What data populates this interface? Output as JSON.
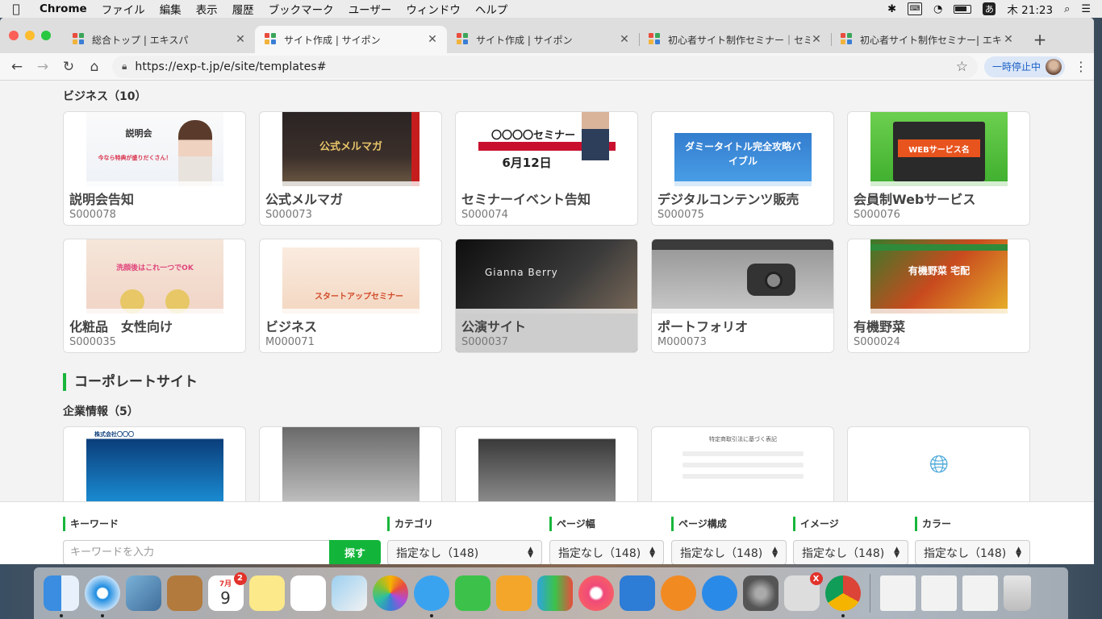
{
  "menubar": {
    "app": "Chrome",
    "items": [
      "ファイル",
      "編集",
      "表示",
      "履歴",
      "ブックマーク",
      "ユーザー",
      "ウィンドウ",
      "ヘルプ"
    ],
    "ime": "あ",
    "clock": "木 21:23"
  },
  "tabs": [
    {
      "title": "総合トップ | エキスパ",
      "active": false
    },
    {
      "title": "サイト作成 | サイポン",
      "active": true
    },
    {
      "title": "サイト作成 | サイポン",
      "active": false
    },
    {
      "title": "初心者サイト制作セミナー｜セミナ",
      "active": false
    },
    {
      "title": "初心者サイト制作セミナー| エキス",
      "active": false
    }
  ],
  "toolbar": {
    "url": "https://exp-t.jp/e/site/templates#",
    "pause_label": "一時停止中"
  },
  "business": {
    "heading": "ビジネス（10）",
    "cards": [
      {
        "title": "説明会告知",
        "code": "S000078"
      },
      {
        "title": "公式メルマガ",
        "code": "S000073"
      },
      {
        "title": "セミナーイベント告知",
        "code": "S000074"
      },
      {
        "title": "デジタルコンテンツ販売",
        "code": "S000075"
      },
      {
        "title": "会員制Webサービス",
        "code": "S000076"
      },
      {
        "title": "化粧品　女性向け",
        "code": "S000035"
      },
      {
        "title": "ビジネス",
        "code": "M000071"
      },
      {
        "title": "公演サイト",
        "code": "S000037"
      },
      {
        "title": "ポートフォリオ",
        "code": "M000073"
      },
      {
        "title": "有機野菜",
        "code": "S000024"
      }
    ]
  },
  "thumbs": {
    "setsumei": "説明会",
    "setsumei_sub": "今なら特典が盛りだくさん！",
    "mailmag": "公式メルマガ",
    "seminar": "〇〇〇〇セミナー",
    "seminar_date": "6月12日",
    "digital": "ダミータイトル完全攻略バイブル",
    "webservice": "WEBサービス名",
    "cosme": "洗顔後はこれ一つでOK",
    "business": "スタートアップセミナー",
    "concert": "Gianna Berry",
    "veg": "有機野菜 宅配",
    "corp1": "株式会社〇〇〇",
    "doc": "特定商取引法に基づく表記"
  },
  "corporate": {
    "section": "コーポレートサイト",
    "heading": "企業情報（5）"
  },
  "filters": {
    "keyword_label": "キーワード",
    "keyword_placeholder": "キーワードを入力",
    "search_label": "探す",
    "category_label": "カテゴリ",
    "category_value": "指定なし（148)",
    "width_label": "ページ幅",
    "width_value": "指定なし（148)",
    "structure_label": "ページ構成",
    "structure_value": "指定なし（148)",
    "image_label": "イメージ",
    "image_value": "指定なし（148)",
    "color_label": "カラー",
    "color_value": "指定なし（148)"
  },
  "dock": {
    "calendar_month": "7月",
    "calendar_day": "9",
    "calendar_badge": "2",
    "disabled_badge": "X"
  },
  "colors": {
    "accent": "#19b63b",
    "search_button": "#12b53a"
  }
}
